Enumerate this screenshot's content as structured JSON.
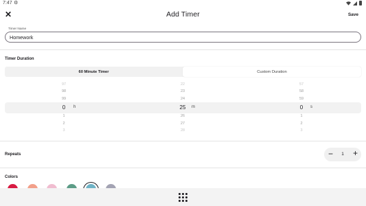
{
  "status_bar": {
    "time": "7:47"
  },
  "header": {
    "title": "Add Timer",
    "save_label": "Save"
  },
  "timer_name": {
    "label": "Timer Name",
    "value": "Homework"
  },
  "duration": {
    "section_label": "Timer Duration",
    "tabs": [
      {
        "label": "60 Minute Timer"
      },
      {
        "label": "Custom Duration"
      }
    ],
    "hours": {
      "items": [
        "97",
        "98",
        "99",
        "0",
        "1",
        "2",
        "3"
      ],
      "unit": "h"
    },
    "minutes": {
      "items": [
        "22",
        "23",
        "24",
        "25",
        "26",
        "27",
        "28"
      ],
      "unit": "m"
    },
    "seconds": {
      "items": [
        "57",
        "58",
        "59",
        "0",
        "1",
        "2",
        "3"
      ],
      "unit": "s"
    }
  },
  "repeats": {
    "label": "Repeats",
    "value": "1"
  },
  "colors": {
    "label": "Colors",
    "swatches": [
      "#d81b42",
      "#f2a08a",
      "#f0bdd0",
      "#5c9c86",
      "#6fb3c6",
      "#a3a3b3"
    ],
    "selected_index": 4
  }
}
